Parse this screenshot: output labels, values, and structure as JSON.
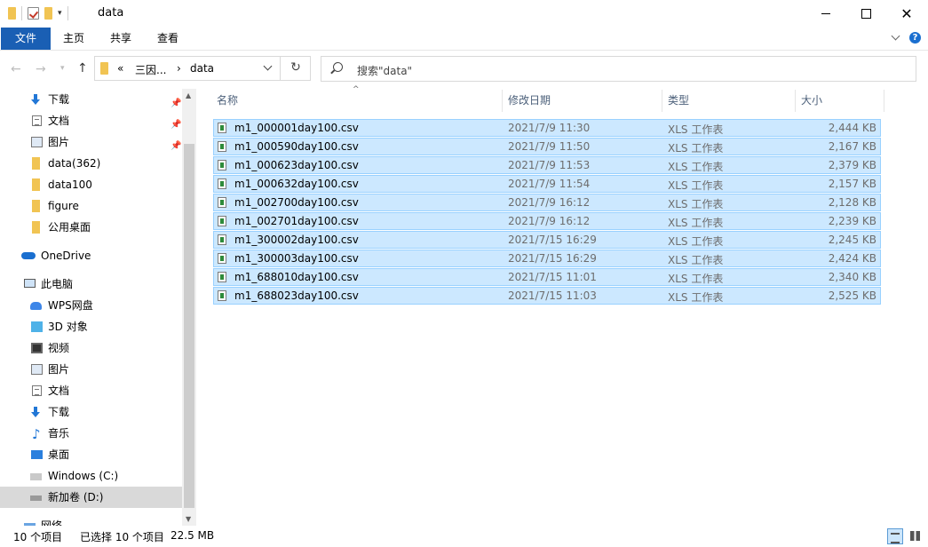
{
  "window": {
    "title": "data",
    "controls": {
      "minimize": "—",
      "maximize": "□",
      "close": "✕"
    }
  },
  "ribbon": {
    "tabs": [
      {
        "label": "文件"
      },
      {
        "label": "主页"
      },
      {
        "label": "共享"
      },
      {
        "label": "查看"
      }
    ]
  },
  "nav": {
    "back_icon": "back-arrow-icon",
    "forward_icon": "forward-arrow-icon",
    "up_icon": "up-arrow-icon",
    "address": {
      "overflow": "«",
      "segments": [
        "三因...",
        "data"
      ],
      "separator": "›"
    },
    "refresh_glyph": "↻",
    "search_placeholder": "搜索\"data\""
  },
  "sidebar": {
    "items": [
      {
        "label": "下载",
        "icon": "download-icon",
        "pinned": true
      },
      {
        "label": "文档",
        "icon": "document-icon",
        "pinned": true
      },
      {
        "label": "图片",
        "icon": "pictures-icon",
        "pinned": true
      },
      {
        "label": "data(362)",
        "icon": "folder-icon"
      },
      {
        "label": "data100",
        "icon": "folder-icon"
      },
      {
        "label": "figure",
        "icon": "folder-icon"
      },
      {
        "label": "公用桌面",
        "icon": "folder-icon"
      },
      {
        "label": "OneDrive",
        "icon": "onedrive-icon"
      },
      {
        "label": "此电脑",
        "icon": "pc-icon"
      },
      {
        "label": "WPS网盘",
        "icon": "wps-cloud-icon"
      },
      {
        "label": "3D 对象",
        "icon": "3d-objects-icon"
      },
      {
        "label": "视频",
        "icon": "video-icon"
      },
      {
        "label": "图片",
        "icon": "pictures-icon"
      },
      {
        "label": "文档",
        "icon": "document-icon"
      },
      {
        "label": "下载",
        "icon": "download-icon"
      },
      {
        "label": "音乐",
        "icon": "music-icon"
      },
      {
        "label": "桌面",
        "icon": "desktop-icon"
      },
      {
        "label": "Windows (C:)",
        "icon": "drive-c-icon"
      },
      {
        "label": "新加卷 (D:)",
        "icon": "drive-d-icon",
        "selected": true
      },
      {
        "label": "网络",
        "icon": "network-icon"
      }
    ]
  },
  "columns": {
    "name": "名称",
    "modified": "修改日期",
    "type": "类型",
    "size": "大小"
  },
  "files": [
    {
      "name": "m1_000001day100.csv",
      "modified": "2021/7/9 11:30",
      "type": "XLS 工作表",
      "size": "2,444 KB"
    },
    {
      "name": "m1_000590day100.csv",
      "modified": "2021/7/9 11:50",
      "type": "XLS 工作表",
      "size": "2,167 KB"
    },
    {
      "name": "m1_000623day100.csv",
      "modified": "2021/7/9 11:53",
      "type": "XLS 工作表",
      "size": "2,379 KB"
    },
    {
      "name": "m1_000632day100.csv",
      "modified": "2021/7/9 11:54",
      "type": "XLS 工作表",
      "size": "2,157 KB"
    },
    {
      "name": "m1_002700day100.csv",
      "modified": "2021/7/9 16:12",
      "type": "XLS 工作表",
      "size": "2,128 KB"
    },
    {
      "name": "m1_002701day100.csv",
      "modified": "2021/7/9 16:12",
      "type": "XLS 工作表",
      "size": "2,239 KB"
    },
    {
      "name": "m1_300002day100.csv",
      "modified": "2021/7/15 16:29",
      "type": "XLS 工作表",
      "size": "2,245 KB"
    },
    {
      "name": "m1_300003day100.csv",
      "modified": "2021/7/15 16:29",
      "type": "XLS 工作表",
      "size": "2,424 KB"
    },
    {
      "name": "m1_688010day100.csv",
      "modified": "2021/7/15 11:01",
      "type": "XLS 工作表",
      "size": "2,340 KB"
    },
    {
      "name": "m1_688023day100.csv",
      "modified": "2021/7/15 11:03",
      "type": "XLS 工作表",
      "size": "2,525 KB"
    }
  ],
  "status": {
    "count": "10 个项目",
    "selected": "已选择 10 个项目",
    "size": "22.5 MB"
  },
  "colors": {
    "file_tab": "#1a5fb4",
    "selection_fill": "#cce8ff",
    "selection_border": "#99d1ff",
    "folder": "#f1c453"
  }
}
